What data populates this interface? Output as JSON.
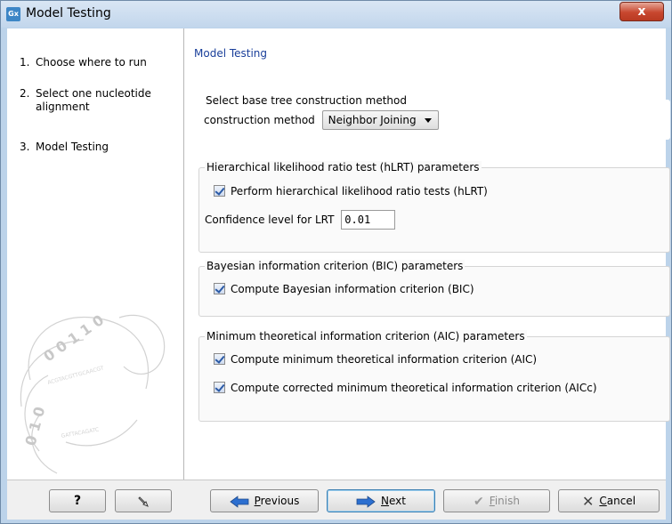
{
  "window": {
    "title": "Model Testing",
    "app_icon": "Gx",
    "close_glyph": "x"
  },
  "steps": [
    {
      "num": "1.",
      "label": "Choose where to run"
    },
    {
      "num": "2.",
      "label": "Select one nucleotide alignment"
    },
    {
      "num": "3.",
      "label": "Model Testing"
    }
  ],
  "panel": {
    "title": "Model Testing",
    "tree_group": {
      "legend": "Select base tree construction method",
      "method_label": "construction method",
      "method_value": "Neighbor Joining"
    },
    "hlrt_group": {
      "legend": "Hierarchical likelihood ratio test (hLRT) parameters",
      "checkbox_label": "Perform hierarchical likelihood ratio tests (hLRT)",
      "confidence_label": "Confidence level for LRT",
      "confidence_value": "0.01"
    },
    "bic_group": {
      "legend": "Bayesian information criterion (BIC) parameters",
      "checkbox_label": "Compute Bayesian information criterion (BIC)"
    },
    "aic_group": {
      "legend": "Minimum theoretical information criterion (AIC) parameters",
      "checkbox_aic": "Compute minimum theoretical information criterion (AIC)",
      "checkbox_aicc": "Compute corrected minimum theoretical information criterion (AICc)"
    }
  },
  "footer": {
    "help": "?",
    "previous_first": "P",
    "previous_rest": "revious",
    "next_first": "N",
    "next_rest": "ext",
    "finish_first": "F",
    "finish_rest": "inish",
    "cancel_first": "C",
    "cancel_rest": "ancel"
  },
  "colors": {
    "panel_title": "#1a3f9a",
    "window_frame": "#bcd3ea"
  }
}
